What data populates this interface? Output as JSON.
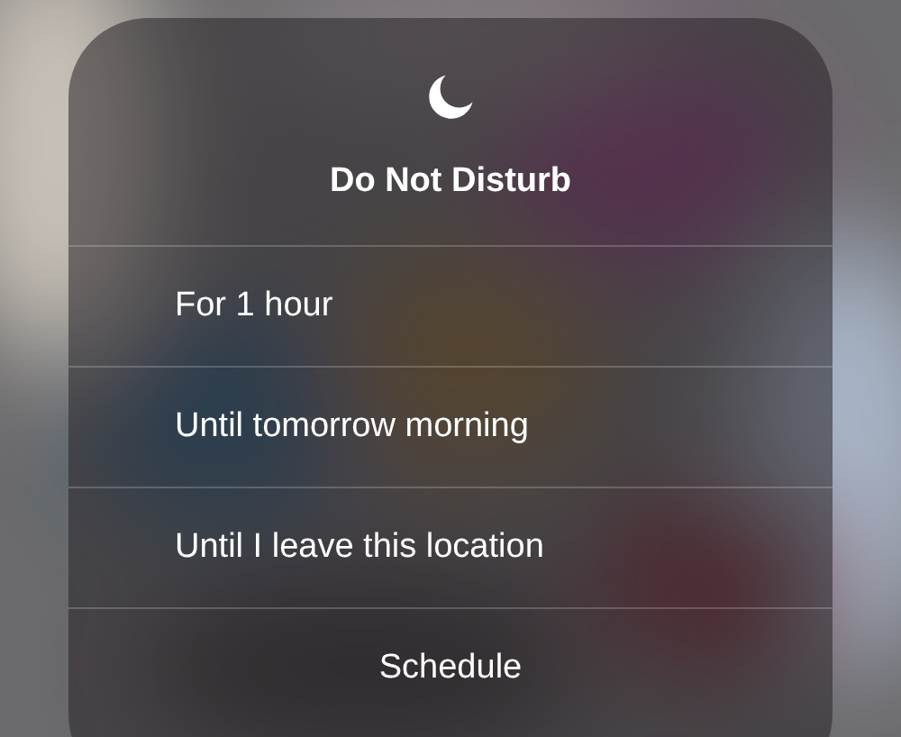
{
  "title": "Do Not Disturb",
  "options": [
    {
      "label": "For 1 hour"
    },
    {
      "label": "Until tomorrow morning"
    },
    {
      "label": "Until I leave this location"
    }
  ],
  "schedule_button": "Schedule"
}
